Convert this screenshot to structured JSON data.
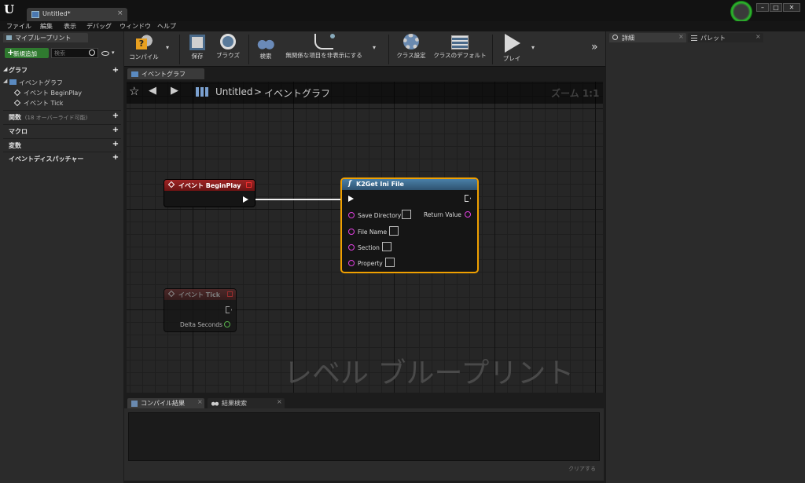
{
  "window": {
    "tab_title": "Untitled*",
    "tab_close": "×",
    "min": "–",
    "max": "□",
    "close": "✕"
  },
  "menu": [
    "ファイル",
    "編集",
    "表示",
    "デバッグ",
    "ウィンドウ",
    "ヘルプ"
  ],
  "my_blueprint": {
    "tab": "マイブループリント",
    "add_new": "新規追加",
    "search_placeholder": "検索",
    "graph_section": "グラフ",
    "event_graph": "イベントグラフ",
    "event_beginplay": "イベント BeginPlay",
    "event_tick": "イベント Tick",
    "functions": "関数",
    "functions_note": "(18 オーバーライド可能)",
    "macros": "マクロ",
    "variables": "変数",
    "dispatchers": "イベントディスパッチャー"
  },
  "toolbar": {
    "compile": "コンパイル",
    "save": "保存",
    "browse": "ブラウズ",
    "search": "検索",
    "hide_unrelated": "無関係な項目を非表示にする",
    "class_settings": "クラス設定",
    "class_defaults": "クラスのデフォルト",
    "play": "プレイ",
    "more": "»"
  },
  "graph_tab": "イベントグラフ",
  "breadcrumb": {
    "root": "Untitled",
    "separator": ">",
    "current": "イベントグラフ"
  },
  "zoom": "ズーム 1:1",
  "watermark": "レベル ブループリント",
  "nodes": {
    "beginplay": {
      "title": "イベント BeginPlay"
    },
    "tick": {
      "title": "イベント Tick",
      "pin": "Delta Seconds"
    },
    "getini": {
      "title": "K2Get Ini File",
      "func_symbol": "f",
      "inputs": [
        "Save Directory",
        "File Name",
        "Section",
        "Property"
      ],
      "output": "Return Value"
    }
  },
  "bottom": {
    "tab_compile": "コンパイル結果",
    "tab_search": "結果検索",
    "clear": "クリアする"
  },
  "details": {
    "tab_details": "詳細",
    "tab_palette": "パレット"
  },
  "colors": {
    "event_head": "#8a1b1b",
    "func_head": "#3d6a8c",
    "select": "#f0a000",
    "pin_pink": "#e040e0",
    "pin_green": "#6be25a"
  }
}
